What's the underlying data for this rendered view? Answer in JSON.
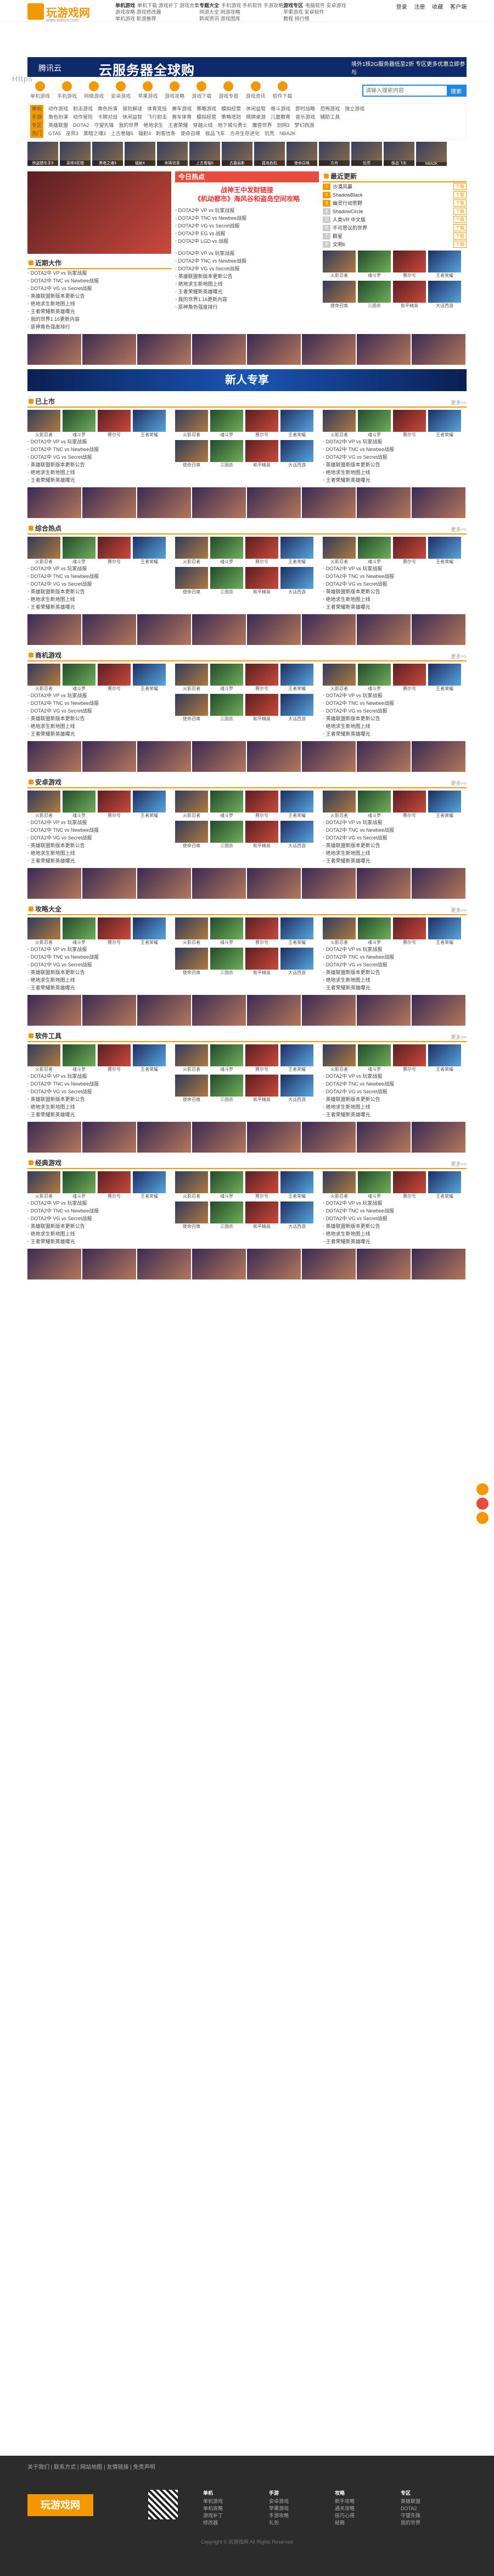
{
  "site": {
    "logo_text": "玩游戏网",
    "logo_url": "www.wanyx.com",
    "watermark": "Https"
  },
  "topnav": {
    "cols": [
      {
        "title": "单机游戏",
        "items": [
          "单机下载 游戏补丁 游戏合集",
          "游戏攻略 游戏修改器",
          "单机游戏 新游推荐"
        ]
      },
      {
        "title": "专题大全",
        "items": [
          "手机游戏 手机软件 手游攻略",
          "网游大全 网游攻略",
          "新闻资讯 游戏图库"
        ]
      },
      {
        "title": "游戏专区",
        "items": [
          "电脑软件 安卓游戏",
          "苹果游戏 安卓软件",
          "教程 排行榜"
        ]
      }
    ],
    "links": [
      "登录",
      "注册",
      "收藏",
      "客户端"
    ]
  },
  "banner": {
    "brand": "腾讯云",
    "title": "云服务器全球购",
    "side": "境外1核2G服务器低至2折 专区更多优惠立即参与"
  },
  "iconbar": {
    "items": [
      "单机游戏",
      "手机游戏",
      "网络游戏",
      "安卓游戏",
      "苹果游戏",
      "游戏攻略",
      "游戏下载",
      "游戏专题",
      "游戏资讯",
      "软件下载"
    ],
    "search_placeholder": "请输入搜索内容",
    "search_button": "搜索"
  },
  "cats": [
    {
      "tag": "单机",
      "items": [
        "动作游戏",
        "射击游戏",
        "角色扮演",
        "冒险解谜",
        "体育竞技",
        "赛车游戏",
        "策略游戏",
        "模拟经营",
        "休闲益智",
        "格斗游戏",
        "即时战略",
        "恐怖游戏",
        "独立游戏"
      ]
    },
    {
      "tag": "手游",
      "items": [
        "角色扮演",
        "动作冒险",
        "卡牌对战",
        "休闲益智",
        "飞行射击",
        "赛车体育",
        "模拟经营",
        "策略塔防",
        "棋牌桌游",
        "儿童教育",
        "音乐游戏",
        "辅助工具"
      ]
    },
    {
      "tag": "专区",
      "items": [
        "英雄联盟",
        "DOTA2",
        "守望先锋",
        "我的世界",
        "绝地求生",
        "王者荣耀",
        "穿越火线",
        "地下城与勇士",
        "魔兽世界",
        "剑网3",
        "梦幻西游"
      ]
    },
    {
      "tag": "热门",
      "items": [
        "GTA5",
        "巫师3",
        "黑暗之魂3",
        "上古卷轴5",
        "辐射4",
        "刺客信条",
        "使命召唤",
        "极品飞车",
        "方舟生存进化",
        "饥荒",
        "NBA2K"
      ]
    }
  ],
  "thumbs": [
    "侠盗猎车手5",
    "巫师3狂猎",
    "黑暗之魂3",
    "辐射4",
    "刺客信条",
    "上古卷轴5",
    "古墓丽影",
    "孤岛危机",
    "使命召唤",
    "方舟",
    "饥荒",
    "极品飞车",
    "NBA2K"
  ],
  "today": {
    "title": "今日热点",
    "headline1": "战神王中发财链接",
    "headline2": "《机动都市》海风谷和盗岛空间攻略",
    "news": [
      "DOTA2中 VP vs 玩家战报",
      "DOTA2中 TNC vs Newbee战报",
      "DOTA2中 VG vs Secret战报",
      "DOTA2中 EG vs 战报",
      "DOTA2中 LGD vs 战报"
    ]
  },
  "hot_rank": {
    "title": "最近更新",
    "items": [
      "沙漠风暴",
      "ShadowBlack",
      "幽灵行动荒野",
      "ShadowCircle",
      "人类VR 中文版",
      "不可思议的世界",
      "群星",
      "文明6"
    ],
    "btn": "下载"
  },
  "bluebar": "新人专享",
  "sections": [
    {
      "title": "近期大作",
      "more": "更多>>"
    },
    {
      "title": "已上市",
      "more": "更多>>"
    },
    {
      "title": "综合热点",
      "more": "更多>>"
    },
    {
      "title": "商机游戏",
      "more": "更多>>"
    },
    {
      "title": "安卓游戏",
      "more": "更多>>"
    },
    {
      "title": "攻略大全",
      "more": "更多>>"
    },
    {
      "title": "软件工具",
      "more": "更多>>"
    },
    {
      "title": "经典游戏",
      "more": "更多>>"
    }
  ],
  "tiles": [
    "火影忍者",
    "魂斗罗",
    "赛尔号",
    "王者荣耀",
    "使命召唤",
    "三国杀",
    "和平精英",
    "大话西游",
    "梦幻西游",
    "阴阳师",
    "我的世界",
    "原神"
  ],
  "listitems": [
    "DOTA2中 VP vs 玩家战报",
    "DOTA2中 TNC vs Newbee战报",
    "DOTA2中 VG vs Secret战报",
    "英雄联盟新版本更新公告",
    "绝地求生新地图上线",
    "王者荣耀新英雄曝光",
    "我的世界1.16更新内容",
    "原神角色强度排行"
  ],
  "footer": {
    "nav": "关于我们 | 联系方式 | 网站地图 | 友情链接 | 免责声明",
    "logo": "玩游戏网",
    "cols": [
      {
        "title": "单机",
        "items": [
          "单机游戏",
          "单机攻略",
          "游戏补丁",
          "修改器"
        ]
      },
      {
        "title": "手游",
        "items": [
          "安卓游戏",
          "苹果游戏",
          "手游攻略",
          "礼包"
        ]
      },
      {
        "title": "攻略",
        "items": [
          "新手攻略",
          "通关攻略",
          "技巧心得",
          "秘籍"
        ]
      },
      {
        "title": "专区",
        "items": [
          "英雄联盟",
          "DOTA2",
          "守望先锋",
          "我的世界"
        ]
      }
    ],
    "copy": "Copyright © 玩游戏网 All Rights Reserved"
  }
}
